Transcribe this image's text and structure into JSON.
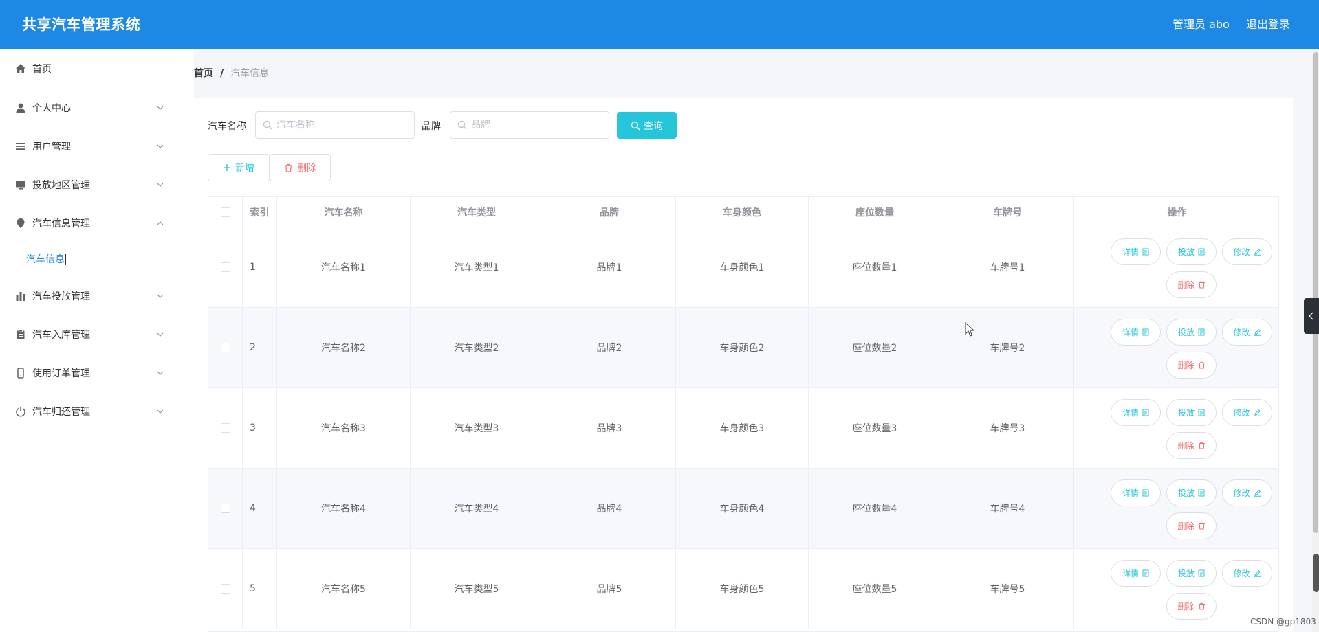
{
  "app": {
    "title": "共享汽车管理系统",
    "user": "管理员 abo",
    "logout": "退出登录"
  },
  "sidebar": {
    "items": [
      {
        "label": "首页",
        "icon": "home-icon"
      },
      {
        "label": "个人中心",
        "icon": "user-icon"
      },
      {
        "label": "用户管理",
        "icon": "list-icon"
      },
      {
        "label": "投放地区管理",
        "icon": "monitor-icon"
      },
      {
        "label": "汽车信息管理",
        "icon": "location-icon"
      },
      {
        "label": "汽车投放管理",
        "icon": "bar-chart-icon"
      },
      {
        "label": "汽车入库管理",
        "icon": "clipboard-icon"
      },
      {
        "label": "使用订单管理",
        "icon": "phone-icon"
      },
      {
        "label": "汽车归还管理",
        "icon": "power-icon"
      }
    ],
    "subitem": "汽车信息"
  },
  "breadcrumb": {
    "home": "首页",
    "sep": "/",
    "current": "汽车信息"
  },
  "search": {
    "name_label": "汽车名称",
    "name_placeholder": "汽车名称",
    "brand_label": "品牌",
    "brand_placeholder": "品牌",
    "query": "查询"
  },
  "actions": {
    "add": "新增",
    "delete": "删除"
  },
  "table": {
    "headers": [
      "索引",
      "汽车名称",
      "汽车类型",
      "品牌",
      "车身颜色",
      "座位数量",
      "车牌号",
      "操作"
    ],
    "rows": [
      [
        "1",
        "汽车名称1",
        "汽车类型1",
        "品牌1",
        "车身颜色1",
        "座位数量1",
        "车牌号1"
      ],
      [
        "2",
        "汽车名称2",
        "汽车类型2",
        "品牌2",
        "车身颜色2",
        "座位数量2",
        "车牌号2"
      ],
      [
        "3",
        "汽车名称3",
        "汽车类型3",
        "品牌3",
        "车身颜色3",
        "座位数量3",
        "车牌号3"
      ],
      [
        "4",
        "汽车名称4",
        "汽车类型4",
        "品牌4",
        "车身颜色4",
        "座位数量4",
        "车牌号4"
      ],
      [
        "5",
        "汽车名称5",
        "汽车类型5",
        "品牌5",
        "车身颜色5",
        "座位数量5",
        "车牌号5"
      ]
    ],
    "row_buttons": {
      "detail": "详情",
      "deploy": "投放",
      "edit": "修改",
      "delete": "删除"
    }
  },
  "watermark": "CSDN @gp1803",
  "colors": {
    "primary": "#1e88e5",
    "cyan": "#26c6da",
    "danger": "#f56c6c"
  }
}
